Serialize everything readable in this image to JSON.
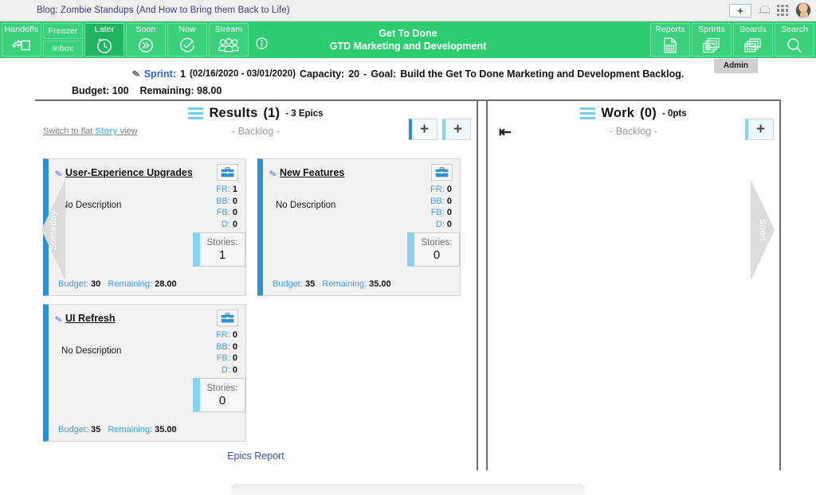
{
  "titlebar": {
    "tab_title": "Blog: Zombie Standups (And How to Bring them Back to Life)",
    "plus_label": "+",
    "bell_icon": "bell-icon",
    "apps_icon": "app-grid-icon",
    "avatar_icon": "user-avatar"
  },
  "appbar": {
    "title_line1": "Get To Done",
    "title_line2": "GTD Marketing and Development",
    "left_nav": [
      {
        "label": "Handoffs",
        "icon": "handoff-icon",
        "active": false
      },
      {
        "label": "Freezer",
        "icon": "freezer-icon",
        "active": false
      },
      {
        "label": "Inbox",
        "icon": "inbox-icon",
        "active": false
      },
      {
        "label": "Later",
        "icon": "clock-icon",
        "active": true
      },
      {
        "label": "Soon",
        "icon": "fast-forward-icon",
        "active": false
      },
      {
        "label": "Now",
        "icon": "check-circle-icon",
        "active": false
      },
      {
        "label": "Stream",
        "icon": "people-icon",
        "active": false
      }
    ],
    "info_icon": "info-icon",
    "right_nav": [
      {
        "label": "Reports",
        "icon": "report-icon"
      },
      {
        "label": "Sprints",
        "icon": "sprints-icon"
      },
      {
        "label": "Boards",
        "icon": "boards-icon"
      },
      {
        "label": "Search",
        "icon": "search-icon"
      }
    ],
    "admin_badge": "Admin"
  },
  "sprint": {
    "pencil_icon": "pencil-icon",
    "sprint_label": "Sprint:",
    "sprint_number": "1",
    "dates": "(02/16/2020 - 03/01/2020)",
    "capacity_label": "Capacity:",
    "capacity_value": "20",
    "separator": "-",
    "goal_label": "Goal:",
    "goal_value": "Build the Get To Done Marketing and Development Backlog.",
    "budget_label": "Budget:",
    "budget_value": "100",
    "remaining_label": "Remaining:",
    "remaining_value": "98.00"
  },
  "columns": {
    "results": {
      "title": "Results",
      "count": "(1)",
      "subtitle": "- 3 Epics",
      "backlog": "- Backlog -",
      "flat_link_pre": "Switch to flat ",
      "flat_link_mid": "Story",
      "flat_link_post": " view",
      "add_primary": "+",
      "add_secondary": "+",
      "epics_report": "Epics Report"
    },
    "work": {
      "title": "Work",
      "count": "(0)",
      "subtitle": "- 0pts",
      "backlog": "- Backlog -",
      "collapse_icon": "collapse-left-icon",
      "add_button": "+"
    }
  },
  "side_arrows": {
    "left": "Someday",
    "right": "Soon"
  },
  "epics": [
    {
      "name": "User-Experience Upgrades",
      "description": "No Description",
      "toolbox_icon": "toolbox-icon",
      "counts": [
        {
          "key": "FR:",
          "value": "1"
        },
        {
          "key": "BB:",
          "value": "0"
        },
        {
          "key": "FB:",
          "value": "0"
        },
        {
          "key": "D:",
          "value": "0"
        }
      ],
      "stories_label": "Stories:",
      "stories_value": "1",
      "budget_label": "Budget:",
      "budget_value": "30",
      "remaining_label": "Remaining:",
      "remaining_value": "28.00"
    },
    {
      "name": "New Features",
      "description": "No Description",
      "toolbox_icon": "toolbox-icon",
      "counts": [
        {
          "key": "FR:",
          "value": "0"
        },
        {
          "key": "BB:",
          "value": "0"
        },
        {
          "key": "FB:",
          "value": "0"
        },
        {
          "key": "D:",
          "value": "0"
        }
      ],
      "stories_label": "Stories:",
      "stories_value": "0",
      "budget_label": "Budget:",
      "budget_value": "35",
      "remaining_label": "Remaining:",
      "remaining_value": "35.00"
    },
    {
      "name": "UI Refresh",
      "description": "No Description",
      "toolbox_icon": "toolbox-icon",
      "counts": [
        {
          "key": "FR:",
          "value": "0"
        },
        {
          "key": "BB:",
          "value": "0"
        },
        {
          "key": "FB:",
          "value": "0"
        },
        {
          "key": "D:",
          "value": "0"
        }
      ],
      "stories_label": "Stories:",
      "stories_value": "0",
      "budget_label": "Budget:",
      "budget_value": "35",
      "remaining_label": "Remaining:",
      "remaining_value": "35.00"
    }
  ],
  "colors": {
    "brand_green": "#2ecc71",
    "brand_green_active": "#21b463",
    "accent_blue": "#2f8fd0",
    "light_blue": "#86d2ef",
    "link_blue": "#3b4fa8"
  }
}
